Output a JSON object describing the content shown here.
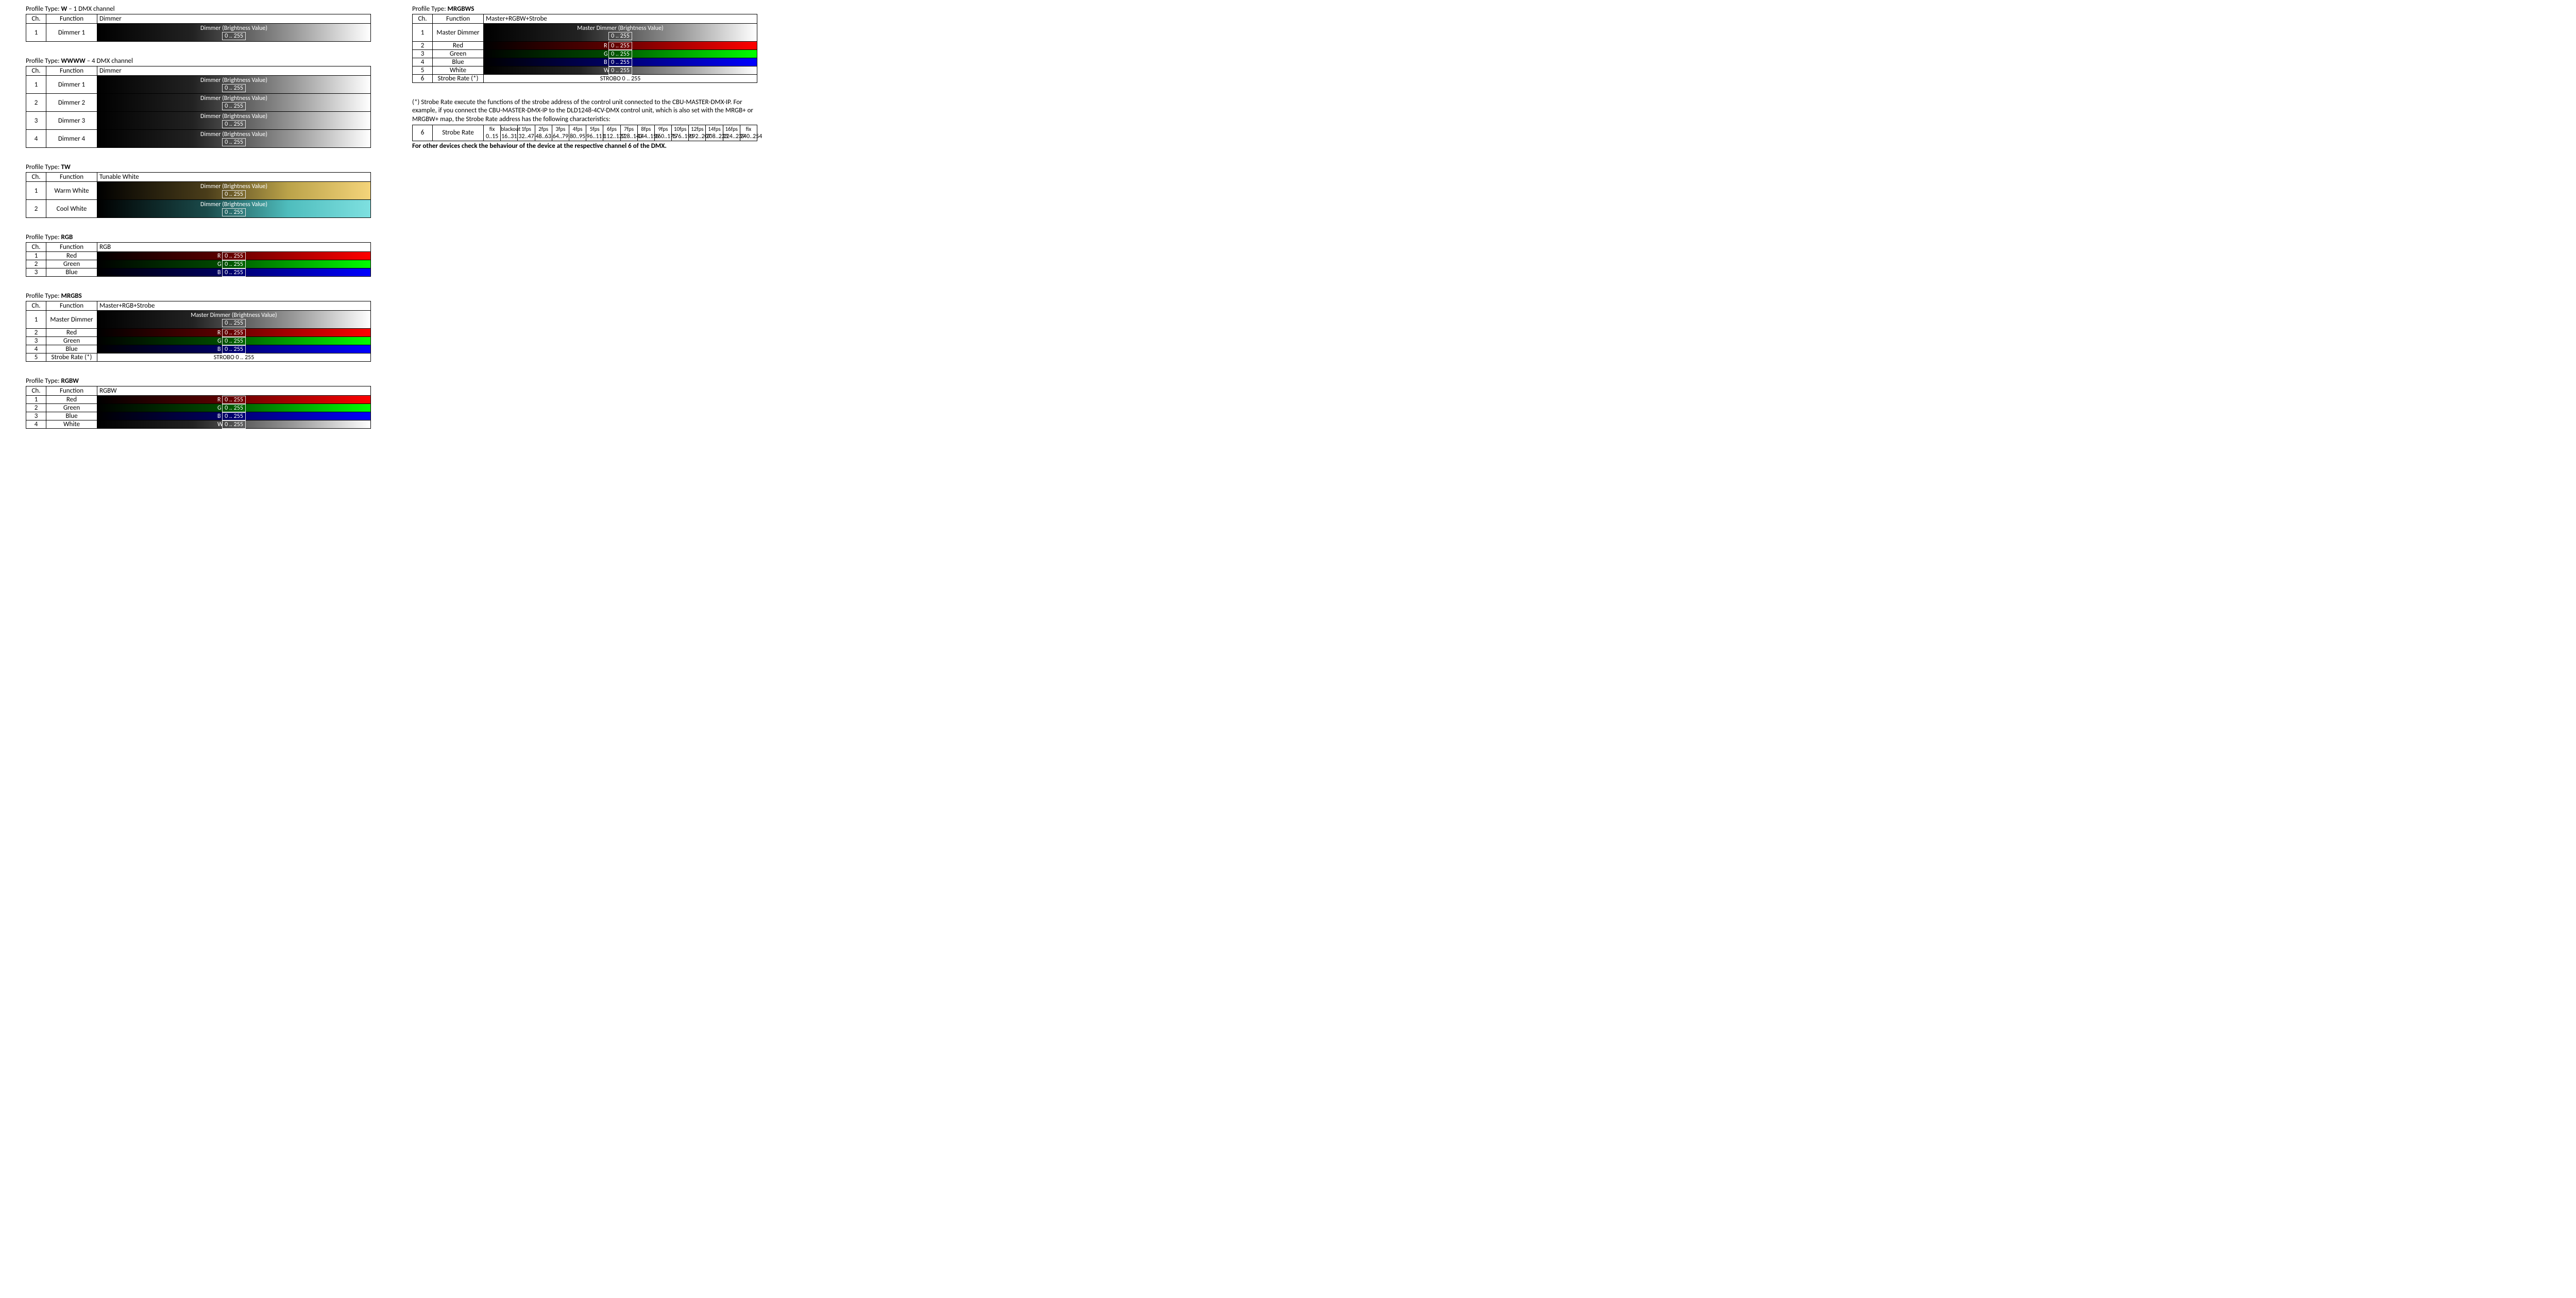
{
  "headers": {
    "ch": "Ch.",
    "fn": "Function"
  },
  "labels": {
    "dimmer": "Dimmer (Brightness Value)",
    "master": "Master Dimmer (Brightness Value)",
    "range": "0 .. 255",
    "strobo": "STROBO 0 .. 255"
  },
  "prefix": {
    "R": "R",
    "G": "G",
    "B": "B",
    "W": "W"
  },
  "profiles": {
    "W": {
      "title_pre": "Profile Type: ",
      "title_b": "W",
      "title_post": " – 1 DMX channel",
      "desc": "Dimmer",
      "rows": [
        {
          "ch": "1",
          "fn": "Dimmer 1",
          "type": "bw",
          "tall": true
        }
      ]
    },
    "WWWW": {
      "title_pre": "Profile Type: ",
      "title_b": "WWWW",
      "title_post": " – 4 DMX channel",
      "desc": "Dimmer",
      "rows": [
        {
          "ch": "1",
          "fn": "Dimmer 1",
          "type": "bw",
          "tall": true
        },
        {
          "ch": "2",
          "fn": "Dimmer 2",
          "type": "bw",
          "tall": true
        },
        {
          "ch": "3",
          "fn": "Dimmer 3",
          "type": "bw",
          "tall": true
        },
        {
          "ch": "4",
          "fn": "Dimmer 4",
          "type": "bw",
          "tall": true
        }
      ]
    },
    "TW": {
      "title_pre": "Profile Type: ",
      "title_b": "TW",
      "title_post": "",
      "desc": "Tunable White",
      "rows": [
        {
          "ch": "1",
          "fn": "Warm White",
          "type": "ww",
          "tall": true
        },
        {
          "ch": "2",
          "fn": "Cool White",
          "type": "cw",
          "tall": true
        }
      ]
    },
    "RGB": {
      "title_pre": "Profile Type: ",
      "title_b": "RGB",
      "title_post": "",
      "desc": "RGB",
      "rows": [
        {
          "ch": "1",
          "fn": "Red",
          "type": "red",
          "prefix": "R"
        },
        {
          "ch": "2",
          "fn": "Green",
          "type": "green",
          "prefix": "G"
        },
        {
          "ch": "3",
          "fn": "Blue",
          "type": "blue",
          "prefix": "B"
        }
      ]
    },
    "MRGBS": {
      "title_pre": "Profile Type: ",
      "title_b": "MRGBS",
      "title_post": "",
      "desc": "Master+RGB+Strobe",
      "rows": [
        {
          "ch": "1",
          "fn": "Master Dimmer",
          "type": "bw",
          "tall": true,
          "master": true
        },
        {
          "ch": "2",
          "fn": "Red",
          "type": "red",
          "prefix": "R"
        },
        {
          "ch": "3",
          "fn": "Green",
          "type": "green",
          "prefix": "G"
        },
        {
          "ch": "4",
          "fn": "Blue",
          "type": "blue",
          "prefix": "B"
        },
        {
          "ch": "5",
          "fn": "Strobe Rate (*)",
          "type": "strobo"
        }
      ]
    },
    "RGBW": {
      "title_pre": "Profile Type: ",
      "title_b": "RGBW",
      "title_post": "",
      "desc": "RGBW",
      "rows": [
        {
          "ch": "1",
          "fn": "Red",
          "type": "red",
          "prefix": "R"
        },
        {
          "ch": "2",
          "fn": "Green",
          "type": "green",
          "prefix": "G"
        },
        {
          "ch": "3",
          "fn": "Blue",
          "type": "blue",
          "prefix": "B"
        },
        {
          "ch": "4",
          "fn": "White",
          "type": "bw",
          "prefix": "W"
        }
      ]
    },
    "MRGBWS": {
      "title_pre": "Profile Type: ",
      "title_b": "MRGBWS",
      "title_post": "",
      "desc": "Master+RGBW+Strobe",
      "rows": [
        {
          "ch": "1",
          "fn": "Master Dimmer",
          "type": "bw",
          "tall": true,
          "master": true
        },
        {
          "ch": "2",
          "fn": "Red",
          "type": "red",
          "prefix": "R"
        },
        {
          "ch": "3",
          "fn": "Green",
          "type": "green",
          "prefix": "G"
        },
        {
          "ch": "4",
          "fn": "Blue",
          "type": "blue",
          "prefix": "B"
        },
        {
          "ch": "5",
          "fn": "White",
          "type": "bw",
          "prefix": "W"
        },
        {
          "ch": "6",
          "fn": "Strobe Rate (*)",
          "type": "strobo"
        }
      ]
    }
  },
  "strobe_note": "(*) Strobe Rate execute the functions of the strobe address of the control unit connected to the CBU-MASTER-DMX-IP. For example, if you connect the CBU-MASTER-DMX-IP to the DLD1248-4CV-DMX control unit, which is also set with the MRGB+ or MRGBW+ map, the Strobe Rate address has the following characteristics:",
  "strobe_table": {
    "ch": "6",
    "fn": "Strobe Rate",
    "segments": [
      {
        "t": "fix",
        "b": "0..15"
      },
      {
        "t": "blackout",
        "b": "16..31"
      },
      {
        "t": "1fps",
        "b": "32..47"
      },
      {
        "t": "2fps",
        "b": "48..63"
      },
      {
        "t": "3fps",
        "b": "64..79"
      },
      {
        "t": "4fps",
        "b": "80..95"
      },
      {
        "t": "5fps",
        "b": "96..111"
      },
      {
        "t": "6fps",
        "b": "112..127"
      },
      {
        "t": "7fps",
        "b": "128..143"
      },
      {
        "t": "8fps",
        "b": "144..159"
      },
      {
        "t": "9fps",
        "b": "160..175"
      },
      {
        "t": "10fps",
        "b": "176..191"
      },
      {
        "t": "12fps",
        "b": "192..207"
      },
      {
        "t": "14fps",
        "b": "208..223"
      },
      {
        "t": "16fps",
        "b": "224..239"
      },
      {
        "t": "fix",
        "b": "240..254"
      }
    ]
  },
  "strobe_after": "For other devices check the behaviour of the device at the respective channel 6 of the DMX."
}
